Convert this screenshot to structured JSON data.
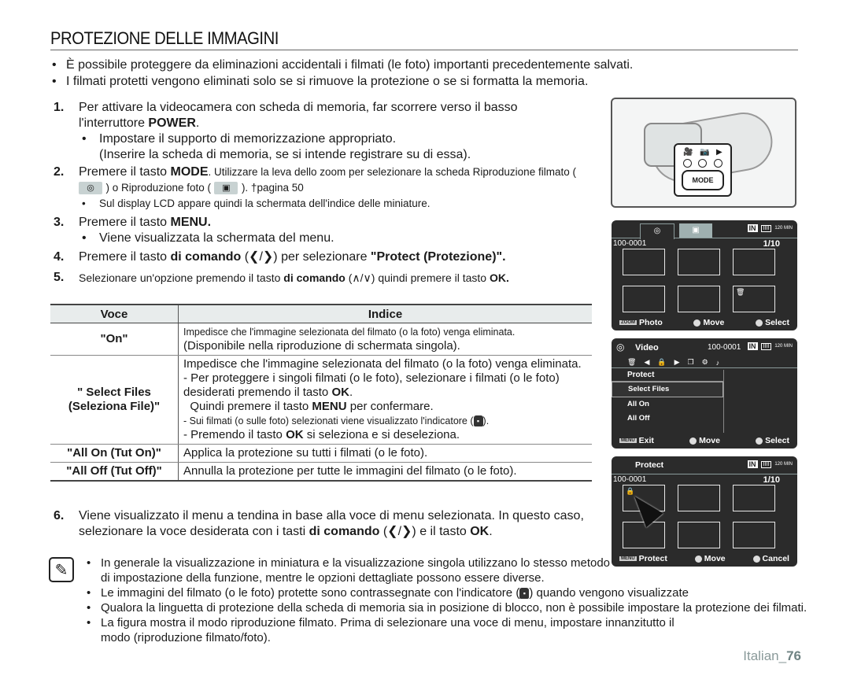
{
  "title": "PROTEZIONE DELLE IMMAGINI",
  "intro": [
    "È possibile proteggere da eliminazioni accidentali i filmati (le foto) importanti precedentemente salvati.",
    "I filmati protetti vengono eliminati solo se si rimuove la protezione o se si formatta la memoria."
  ],
  "steps": {
    "s1": {
      "num": "1.",
      "text_a": "Per attivare la videocamera con scheda di memoria, far scorrere verso il basso l'interruttore ",
      "bold": "POWER",
      "text_b": ".",
      "sub1": "Impostare il supporto di memorizzazione appropriato.",
      "sub1b": "(Inserire la scheda di memoria, se si intende registrare su di essa)."
    },
    "s2": {
      "num": "2.",
      "text_a": "Premere il tasto ",
      "bold": "MODE",
      "text_b": ". Utilizzare la leva dello zoom per selezionare la scheda Riproduzione filmato (",
      "text_c": ") o Riproduzione foto (",
      "text_d": ").  †pagina 50",
      "sub1": "Sul display LCD appare quindi la schermata dell'indice delle miniature."
    },
    "s3": {
      "num": "3.",
      "text_a": "Premere il tasto ",
      "bold": "MENU.",
      "sub1": "Viene visualizzata la schermata del menu."
    },
    "s4": {
      "num": "4.",
      "text_a": "Premere il tasto ",
      "bold": "di comando",
      "text_b": " (❮/❯) per selezionare ",
      "bold2": "\"Protect (Protezione)\"."
    },
    "s5": {
      "num": "5.",
      "text_a": "Selezionare un'opzione premendo il tasto ",
      "bold": "di comando",
      "text_b": " (∧/∨) quindi premere il tasto ",
      "bold2": "OK."
    },
    "s6": {
      "num": "6.",
      "text_a": "Viene visualizzato il menu a tendina in base alla voce di menu selezionata. In questo caso, selezionare la voce desiderata con i tasti ",
      "bold": "di comando",
      "text_b": " (❮/❯) e il tasto ",
      "bold2": "OK",
      "text_c": "."
    }
  },
  "table": {
    "headers": [
      "Voce",
      "Indice"
    ],
    "rows": [
      {
        "voce": "\"On\"",
        "l1": "Impedisce che l'immagine selezionata del filmato (o la foto) venga eliminata.",
        "l2": "(Disponibile nella riproduzione di schermata singola)."
      },
      {
        "voce": "\" Select Files (Seleziona File)\"",
        "l1": "Impedisce che l'immagine selezionata del filmato (o la foto) venga eliminata.",
        "l2a": "- Per proteggere i singoli filmati (o le foto), selezionare i filmati (o le foto) desiderati premendo il tasto ",
        "l2b": "OK",
        "l2c": ".",
        "l3a": "Quindi premere il tasto ",
        "l3b": "MENU",
        "l3c": " per confermare.",
        "l4a": "- Sui filmati (o sulle foto) selezionati viene visualizzato l'indicatore (",
        "l4b": ").",
        "l5a": "-  Premendo il tasto ",
        "l5b": "OK",
        "l5c": " si seleziona e si deseleziona."
      },
      {
        "voce": "\"All On (Tut On)\"",
        "l1": "Applica la protezione su tutti i filmati (o le foto)."
      },
      {
        "voce": "\"All Off (Tut Off)\"",
        "l1": "Annulla la protezione per tutte le immagini del filmato (o le foto)."
      }
    ]
  },
  "notes": [
    "In generale la visualizzazione in miniatura e la visualizzazione singola utilizzano lo stesso metodo di impostazione della funzione, mentre le opzioni dettagliate possono essere diverse.",
    {
      "a": "Le immagini del filmato (o le foto) protette sono contrassegnate con l'indicatore (",
      "b": ") quando vengono visualizzate"
    },
    "Qualora la linguetta di protezione della scheda di memoria sia in posizione di blocco, non è possibile impostare la protezione dei filmati.",
    "La figura mostra il modo riproduzione filmato. Prima di selezionare una voce di menu, impostare innanzitutto il modo (riproduzione filmato/foto)."
  ],
  "footer": {
    "lang": "Italian_",
    "page": "76"
  },
  "camera": {
    "mode_label": "MODE",
    "icons": [
      "🎥",
      "📷",
      "▶"
    ]
  },
  "screen1": {
    "file": "100-0001",
    "count": "1/10",
    "status": {
      "storage": "IN",
      "battery": "IIII",
      "min": "120 MIN"
    },
    "foot": {
      "k1": "ZOOM",
      "l1": "Photo",
      "l2": "Move",
      "l3": "Select"
    }
  },
  "screen2": {
    "title": "Video",
    "file": "100-0001",
    "status": {
      "storage": "IN",
      "battery": "IIII",
      "min": "120 MIN"
    },
    "menu_title": "Protect",
    "items": [
      "Select Files",
      "All On",
      "All Off"
    ],
    "foot": {
      "k1": "MENU",
      "l1": "Exit",
      "l2": "Move",
      "l3": "Select"
    }
  },
  "screen3": {
    "title": "Protect",
    "file": "100-0001",
    "count": "1/10",
    "status": {
      "storage": "IN",
      "battery": "IIII",
      "min": "120 MIN"
    },
    "foot": {
      "k1": "MENU",
      "l1": "Protect",
      "l2": "Move",
      "l3": "Cancel"
    }
  }
}
